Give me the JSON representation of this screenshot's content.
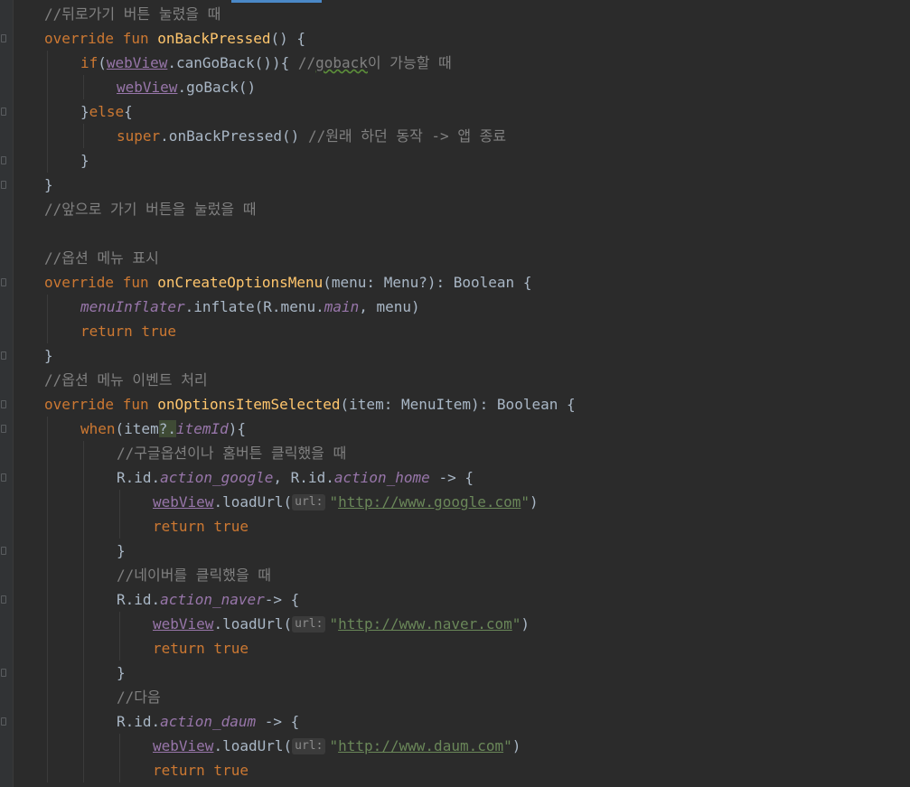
{
  "editor": {
    "lines": [
      {
        "indent": 0,
        "tokens": [
          {
            "t": "//뒤로가기 버튼 눌렸을 때",
            "c": "cm"
          }
        ]
      },
      {
        "indent": 0,
        "tokens": [
          {
            "t": "override fun ",
            "c": "kw"
          },
          {
            "t": "onBackPressed",
            "c": "fn"
          },
          {
            "t": "() {",
            "c": "txt"
          }
        ]
      },
      {
        "indent": 1,
        "tokens": [
          {
            "t": "if",
            "c": "kw"
          },
          {
            "t": "(",
            "c": "txt"
          },
          {
            "t": "webView",
            "c": "fld"
          },
          {
            "t": ".canGoBack()){ ",
            "c": "txt"
          },
          {
            "t": "//",
            "c": "cm"
          },
          {
            "t": "goback",
            "c": "cm typo"
          },
          {
            "t": "이 가능할 때",
            "c": "cm"
          }
        ]
      },
      {
        "indent": 2,
        "tokens": [
          {
            "t": "webView",
            "c": "fld"
          },
          {
            "t": ".goBack()",
            "c": "txt"
          }
        ]
      },
      {
        "indent": 1,
        "tokens": [
          {
            "t": "}",
            "c": "txt"
          },
          {
            "t": "else",
            "c": "kw"
          },
          {
            "t": "{",
            "c": "txt"
          }
        ]
      },
      {
        "indent": 2,
        "tokens": [
          {
            "t": "super",
            "c": "kw"
          },
          {
            "t": ".onBackPressed() ",
            "c": "txt"
          },
          {
            "t": "//원래 하던 동작 -> 앱 종료",
            "c": "cm"
          }
        ]
      },
      {
        "indent": 1,
        "tokens": [
          {
            "t": "}",
            "c": "txt"
          }
        ]
      },
      {
        "indent": 0,
        "tokens": [
          {
            "t": "}",
            "c": "txt"
          }
        ]
      },
      {
        "indent": 0,
        "tokens": [
          {
            "t": "//앞으로 가기 버튼을 눌렀을 때",
            "c": "cm"
          }
        ]
      },
      {
        "indent": 0,
        "tokens": []
      },
      {
        "indent": 0,
        "tokens": [
          {
            "t": "//옵션 메뉴 표시",
            "c": "cm"
          }
        ]
      },
      {
        "indent": 0,
        "tokens": [
          {
            "t": "override fun ",
            "c": "kw"
          },
          {
            "t": "onCreateOptionsMenu",
            "c": "fn"
          },
          {
            "t": "(menu: Menu?): Boolean {",
            "c": "txt"
          }
        ]
      },
      {
        "indent": 1,
        "tokens": [
          {
            "t": "menuInflater",
            "c": "prop"
          },
          {
            "t": ".inflate(R.menu.",
            "c": "txt"
          },
          {
            "t": "main",
            "c": "prop"
          },
          {
            "t": ", menu)",
            "c": "txt"
          }
        ]
      },
      {
        "indent": 1,
        "tokens": [
          {
            "t": "return true",
            "c": "kw"
          }
        ]
      },
      {
        "indent": 0,
        "tokens": [
          {
            "t": "}",
            "c": "txt"
          }
        ]
      },
      {
        "indent": 0,
        "tokens": [
          {
            "t": "//옵션 메뉴 이벤트 처리",
            "c": "cm"
          }
        ]
      },
      {
        "indent": 0,
        "tokens": [
          {
            "t": "override fun ",
            "c": "kw"
          },
          {
            "t": "onOptionsItemSelected",
            "c": "fn"
          },
          {
            "t": "(item: MenuItem): Boolean {",
            "c": "txt"
          }
        ]
      },
      {
        "indent": 1,
        "tokens": [
          {
            "t": "when",
            "c": "kw"
          },
          {
            "t": "(item",
            "c": "txt"
          },
          {
            "t": "?.",
            "c": "txt hl-qdot"
          },
          {
            "t": "itemId",
            "c": "prop"
          },
          {
            "t": "){",
            "c": "txt"
          }
        ]
      },
      {
        "indent": 2,
        "tokens": [
          {
            "t": "//구글옵션이나 홈버튼 클릭했을 때",
            "c": "cm"
          }
        ]
      },
      {
        "indent": 2,
        "tokens": [
          {
            "t": "R.id.",
            "c": "txt"
          },
          {
            "t": "action_google",
            "c": "prop"
          },
          {
            "t": ", R.id.",
            "c": "txt"
          },
          {
            "t": "action_home",
            "c": "prop"
          },
          {
            "t": " -> {",
            "c": "txt"
          }
        ]
      },
      {
        "indent": 3,
        "tokens": [
          {
            "t": "webView",
            "c": "fld"
          },
          {
            "t": ".loadUrl(",
            "c": "txt"
          },
          {
            "hint": "url:"
          },
          {
            "t": "\"",
            "c": "str"
          },
          {
            "t": "http://www.google.com",
            "c": "str link"
          },
          {
            "t": "\"",
            "c": "str"
          },
          {
            "t": ")",
            "c": "txt"
          }
        ]
      },
      {
        "indent": 3,
        "tokens": [
          {
            "t": "return true",
            "c": "kw"
          }
        ]
      },
      {
        "indent": 2,
        "tokens": [
          {
            "t": "}",
            "c": "txt"
          }
        ]
      },
      {
        "indent": 2,
        "tokens": [
          {
            "t": "//네이버를 클릭했을 때",
            "c": "cm"
          }
        ]
      },
      {
        "indent": 2,
        "tokens": [
          {
            "t": "R.id.",
            "c": "txt"
          },
          {
            "t": "action_naver",
            "c": "prop"
          },
          {
            "t": "-> {",
            "c": "txt"
          }
        ]
      },
      {
        "indent": 3,
        "tokens": [
          {
            "t": "webView",
            "c": "fld"
          },
          {
            "t": ".loadUrl(",
            "c": "txt"
          },
          {
            "hint": "url:"
          },
          {
            "t": "\"",
            "c": "str"
          },
          {
            "t": "http://www.naver.com",
            "c": "str link"
          },
          {
            "t": "\"",
            "c": "str"
          },
          {
            "t": ")",
            "c": "txt"
          }
        ]
      },
      {
        "indent": 3,
        "tokens": [
          {
            "t": "return true",
            "c": "kw"
          }
        ]
      },
      {
        "indent": 2,
        "tokens": [
          {
            "t": "}",
            "c": "txt"
          }
        ]
      },
      {
        "indent": 2,
        "tokens": [
          {
            "t": "//다음",
            "c": "cm"
          }
        ]
      },
      {
        "indent": 2,
        "tokens": [
          {
            "t": "R.id.",
            "c": "txt"
          },
          {
            "t": "action_daum",
            "c": "prop"
          },
          {
            "t": " -> {",
            "c": "txt"
          }
        ]
      },
      {
        "indent": 3,
        "tokens": [
          {
            "t": "webView",
            "c": "fld"
          },
          {
            "t": ".loadUrl(",
            "c": "txt"
          },
          {
            "hint": "url:"
          },
          {
            "t": "\"",
            "c": "str"
          },
          {
            "t": "http://www.daum.com",
            "c": "str link"
          },
          {
            "t": "\"",
            "c": "str"
          },
          {
            "t": ")",
            "c": "txt"
          }
        ]
      },
      {
        "indent": 3,
        "tokens": [
          {
            "t": "return true",
            "c": "kw"
          }
        ]
      }
    ]
  },
  "colors": {
    "background": "#2b2b2b",
    "keyword": "#cc7832",
    "function": "#ffc66d",
    "comment": "#808080",
    "property": "#9876aa",
    "string": "#6a8759",
    "text": "#a9b7c6"
  }
}
